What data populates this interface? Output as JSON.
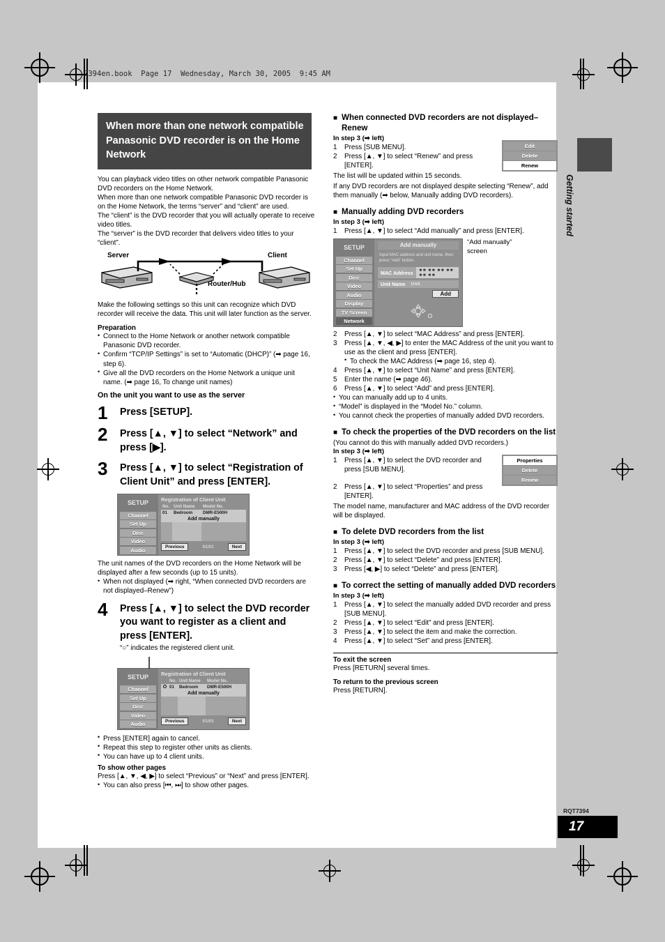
{
  "file_header": "7394en.book  Page 17  Wednesday, March 30, 2005  9:45 AM",
  "side_tab": {
    "label": "Getting started"
  },
  "footer": {
    "doc_code": "RQT7394",
    "page_number": "17"
  },
  "left": {
    "banner_title": "When more than one network compatible Panasonic DVD recorder is on the Home Network",
    "intro": [
      "You can playback video titles on other network compatible Panasonic DVD recorders on the Home Network.",
      "When more than one network compatible Panasonic DVD recorder is on the Home Network, the terms “server” and “client” are used.",
      "The “client” is the DVD recorder that you will actually operate to receive video titles.",
      "The “server” is the DVD recorder that delivers video titles to your “client”."
    ],
    "diagram": {
      "server_label": "Server",
      "client_label": "Client",
      "router_label": "Router/Hub"
    },
    "after_diagram": "Make the following settings so this unit can recognize which DVD recorder will receive the data. This unit will later function as the server.",
    "preparation_heading": "Preparation",
    "preparation_items": [
      "Connect to the Home Network or another network compatible Panasonic DVD recorder.",
      "Confirm “TCP/IP Settings” is set to “Automatic (DHCP)” (➡ page 16, step 6).",
      "Give all the DVD recorders on the Home Network a unique unit name. (➡ page 16, To change unit names)"
    ],
    "server_heading": "On the unit you want to use as the server",
    "steps": [
      {
        "num": "1",
        "text": "Press [SETUP]."
      },
      {
        "num": "2",
        "text": "Press [▲, ▼] to select “Network” and press [▶]."
      },
      {
        "num": "3",
        "text": "Press [▲, ▼] to select “Registration of Client Unit” and press [ENTER]."
      }
    ],
    "osd1": {
      "title": "SETUP",
      "menu": [
        "Channel",
        "Set Up",
        "Disc",
        "Video",
        "Audio"
      ],
      "screen_title": "Registration of Client Unit",
      "columns": [
        "No.",
        "Unit Name",
        "Model No."
      ],
      "rows": [
        [
          "01",
          "Bedroom",
          "DMR-E500H"
        ]
      ],
      "add_manually": "Add manually",
      "previous": "Previous",
      "page_indicator": "01/01",
      "next": "Next"
    },
    "after_step3": "The unit names of the DVD recorders on the Home Network will be displayed after a few seconds (up to 15 units).",
    "after_step3_bullet": "When not displayed (➡ right, “When connected DVD recorders are not displayed–Renew”)",
    "step4": {
      "num": "4",
      "text": "Press [▲, ▼] to select the DVD recorder you want to register as a client and press [ENTER]."
    },
    "step4_note": "“○” indicates the registered client unit.",
    "osd2_caption": "",
    "step4_bullets": [
      "Press [ENTER] again to cancel.",
      "Repeat this step to register other units as clients.",
      "You can have up to 4 client units."
    ],
    "other_pages_heading": "To show other pages",
    "other_pages_text": "Press [▲, ▼, ◀, ▶] to select “Previous” or “Next” and press [ENTER].",
    "other_pages_bullet": "You can also press [⏮, ⏭] to show other pages."
  },
  "right": {
    "sec1": {
      "heading": "When connected DVD recorders are not displayed–Renew",
      "in_step": "In step 3 (➡ left)",
      "items": [
        "Press [SUB MENU].",
        "Press [▲, ▼] to select “Renew” and press [ENTER]."
      ],
      "menu": [
        "Edit",
        "Delete",
        "Renew"
      ],
      "menu_highlight": "Renew",
      "notes": [
        "The list will be updated within 15 seconds.",
        "If any DVD recorders are not displayed despite selecting “Renew”, add them manually (➡ below, Manually adding DVD recorders)."
      ]
    },
    "sec2": {
      "heading": "Manually adding DVD recorders",
      "in_step": "In step 3 (➡ left)",
      "item1": "Press [▲, ▼] to select “Add manually” and press [ENTER].",
      "screen_caption": "“Add manually” screen",
      "osd": {
        "title": "SETUP",
        "menu": [
          "Channel",
          "Set Up",
          "Disc",
          "Video",
          "Audio",
          "Display",
          "TV Screen",
          "Network"
        ],
        "selected_menu": "Network",
        "screen_title": "Add manually",
        "instruction": "Input MAC address and unit name, then press “Add” button.",
        "mac_label": "MAC Address",
        "mac_value": "∗∗ ∗∗ ∗∗ ∗∗ ∗∗ ∗∗",
        "unit_label": "Unit Name",
        "unit_value": "Unit",
        "add_button": "Add"
      },
      "items": [
        {
          "n": "2",
          "t": "Press [▲, ▼] to select “MAC Address” and press [ENTER]."
        },
        {
          "n": "3",
          "t": "Press [▲, ▼, ◀, ▶] to enter the MAC Address of the unit you want to use as the client and press [ENTER]."
        },
        {
          "n": "4",
          "t": "Press [▲, ▼] to select “Unit Name” and press [ENTER]."
        },
        {
          "n": "5",
          "t": "Enter the name (➡ page 46)."
        },
        {
          "n": "6",
          "t": "Press [▲, ▼] to select “Add” and press [ENTER]."
        }
      ],
      "sub_bullet3": "To check the MAC Address (➡ page 16, step 4).",
      "bullets": [
        "You can manually add up to 4 units.",
        "“Model” is displayed in the “Model No.” column.",
        "You cannot check the properties of manually added DVD recorders."
      ]
    },
    "sec3": {
      "heading": "To check the properties of the DVD recorders on the list",
      "note": "(You cannot do this with manually added DVD recorders.)",
      "in_step": "In step 3 (➡ left)",
      "items": [
        "Press [▲, ▼] to select the DVD recorder and press [SUB MENU].",
        "Press [▲, ▼] to select “Properties” and press [ENTER]."
      ],
      "menu": [
        "Properties",
        "Delete",
        "Renew"
      ],
      "menu_highlight": "Properties",
      "result": "The model name, manufacturer and MAC address of the DVD recorder will be displayed."
    },
    "sec4": {
      "heading": "To delete DVD recorders from the list",
      "in_step": "In step 3 (➡ left)",
      "items": [
        "Press [▲, ▼] to select the DVD recorder and press [SUB MENU].",
        "Press [▲, ▼] to select “Delete” and press [ENTER].",
        "Press [◀, ▶] to select “Delete” and press [ENTER]."
      ]
    },
    "sec5": {
      "heading": "To correct the setting of manually added DVD recorders",
      "in_step": "In step 3 (➡ left)",
      "items": [
        "Press [▲, ▼] to select the manually added DVD recorder and press [SUB MENU].",
        "Press [▲, ▼] to select “Edit” and press [ENTER].",
        "Press [▲, ▼] to select the item and make the correction.",
        "Press [▲, ▼] to select “Set” and press [ENTER]."
      ]
    },
    "exit": {
      "heading": "To exit the screen",
      "text": "Press [RETURN] several times."
    },
    "back": {
      "heading": "To return to the previous screen",
      "text": "Press [RETURN]."
    }
  }
}
